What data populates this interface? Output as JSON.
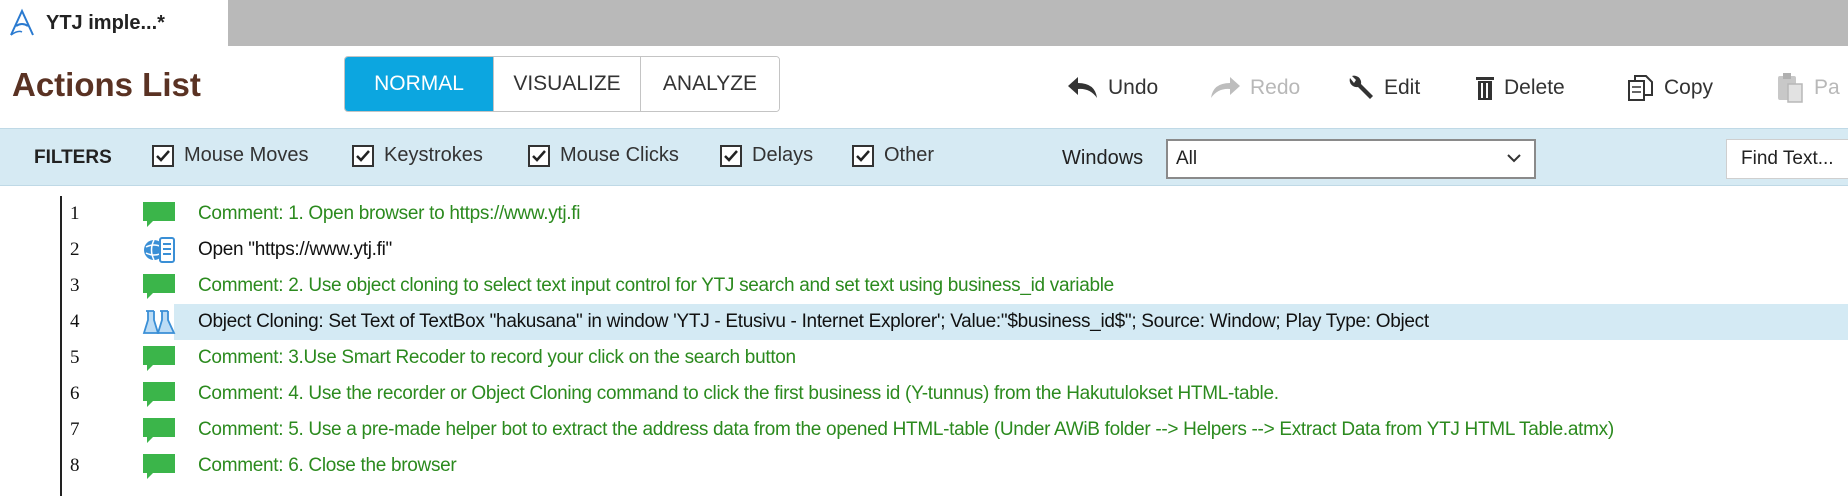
{
  "tab": {
    "title": "YTJ imple...*",
    "icon": "app-logo-icon"
  },
  "header": {
    "title": "Actions List",
    "modes": [
      {
        "label": "NORMAL",
        "active": true
      },
      {
        "label": "VISUALIZE",
        "active": false
      },
      {
        "label": "ANALYZE",
        "active": false
      }
    ],
    "toolbar": {
      "undo": {
        "label": "Undo",
        "icon": "undo-icon"
      },
      "redo": {
        "label": "Redo",
        "icon": "redo-icon",
        "disabled": true
      },
      "edit": {
        "label": "Edit",
        "icon": "wrench-icon"
      },
      "delete": {
        "label": "Delete",
        "icon": "trash-icon"
      },
      "copy": {
        "label": "Copy",
        "icon": "copy-icon"
      },
      "paste": {
        "label": "Pa",
        "icon": "paste-icon",
        "disabled": true
      }
    }
  },
  "filters": {
    "label": "FILTERS",
    "items": [
      {
        "label": "Mouse Moves",
        "checked": true
      },
      {
        "label": "Keystrokes",
        "checked": true
      },
      {
        "label": "Mouse Clicks",
        "checked": true
      },
      {
        "label": "Delays",
        "checked": true
      },
      {
        "label": "Other",
        "checked": true
      }
    ],
    "windows_label": "Windows",
    "windows_value": "All",
    "find_text": "Find Text..."
  },
  "colors": {
    "accent": "#0ca6e0",
    "title_brown": "#5a3223",
    "filter_bg": "#d6eaf3",
    "comment_green": "#2b8a1e",
    "selected_row": "#d4eaf4"
  },
  "actions": [
    {
      "num": "1",
      "type": "comment",
      "icon": "comment-icon",
      "text": "Comment: 1. Open browser to https://www.ytj.fi"
    },
    {
      "num": "2",
      "type": "command",
      "icon": "browser-open-icon",
      "text": "Open \"https://www.ytj.fi\""
    },
    {
      "num": "3",
      "type": "comment",
      "icon": "comment-icon",
      "text": "Comment: 2. Use object cloning to select text input control for YTJ search and set text using business_id variable"
    },
    {
      "num": "4",
      "type": "command",
      "icon": "object-cloning-icon",
      "selected": true,
      "text": "Object Cloning: Set Text of TextBox \"hakusana\" in window 'YTJ - Etusivu - Internet Explorer'; Value:\"$business_id$\"; Source: Window; Play Type: Object"
    },
    {
      "num": "5",
      "type": "comment",
      "icon": "comment-icon",
      "text": "Comment: 3.Use Smart Recoder to record your click on the search button"
    },
    {
      "num": "6",
      "type": "comment",
      "icon": "comment-icon",
      "text": "Comment: 4. Use the recorder or Object Cloning command to click the first business id (Y-tunnus) from the Hakutulokset HTML-table."
    },
    {
      "num": "7",
      "type": "comment",
      "icon": "comment-icon",
      "text": "Comment: 5. Use a pre-made helper bot to extract the address data from the opened HTML-table (Under AWiB folder --> Helpers --> Extract Data from YTJ HTML Table.atmx)"
    },
    {
      "num": "8",
      "type": "comment",
      "icon": "comment-icon",
      "text": "Comment: 6. Close the browser"
    }
  ]
}
